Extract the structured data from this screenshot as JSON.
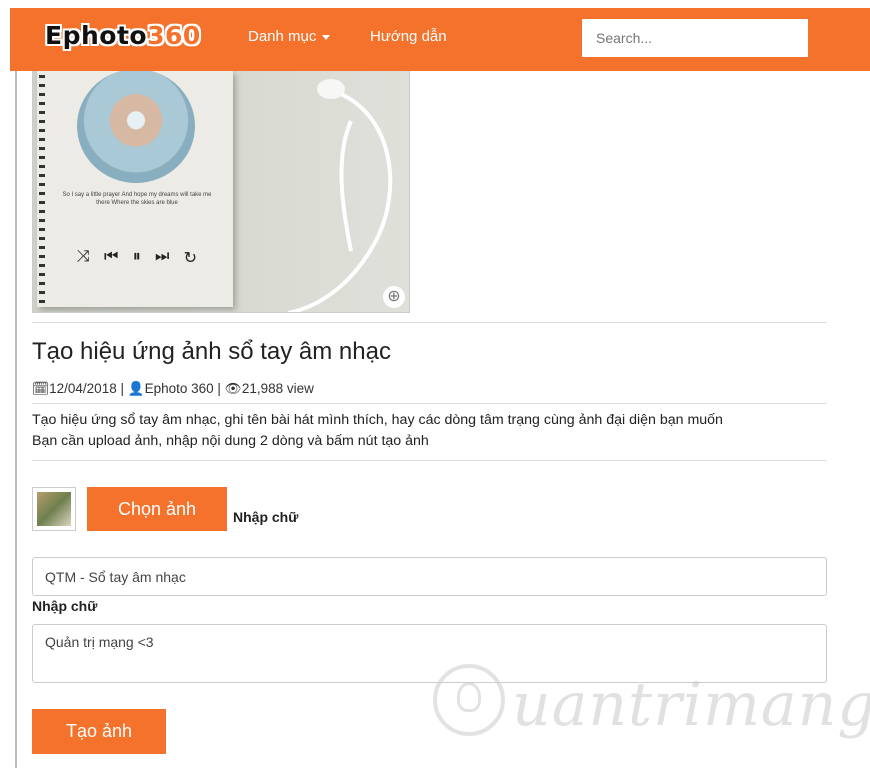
{
  "nav": {
    "brand_text": "Ephoto",
    "brand_num": "360",
    "menu_categories": "Danh mục",
    "menu_guide": "Hướng dẫn",
    "search_placeholder": "Search..."
  },
  "hero": {
    "lyrics": "So I say a little prayer And hope my dreams will take me there Where the skies are blue",
    "player_controls": [
      "⤨",
      "⏮",
      "⏸",
      "⏭",
      "↻"
    ],
    "zoom_icon": "⊕"
  },
  "article": {
    "title": "Tạo hiệu ứng ảnh sổ tay âm nhạc",
    "date": "12/04/2018",
    "author": "Ephoto 360",
    "views": "21,988 view",
    "desc_line1": "Tạo hiệu ứng sổ tay âm nhạc, ghi tên bài hát mình thích, hay các dòng tâm trạng cùng ảnh đại diện bạn muốn",
    "desc_line2": "Bạn cần upload ảnh, nhập nội dung 2 dòng và bấm nút tạo ảnh"
  },
  "form": {
    "choose_photo_label": "Chọn ảnh",
    "input_label_1": "Nhập chữ",
    "text1_value": "QTM - Sổ tay âm nhạc",
    "input_label_2": "Nhập chữ",
    "text2_value": "Quản trị mạng <3",
    "create_label": "Tạo ảnh"
  },
  "watermark": {
    "text": "uantrimang"
  },
  "colors": {
    "brand": "#f4722b"
  }
}
